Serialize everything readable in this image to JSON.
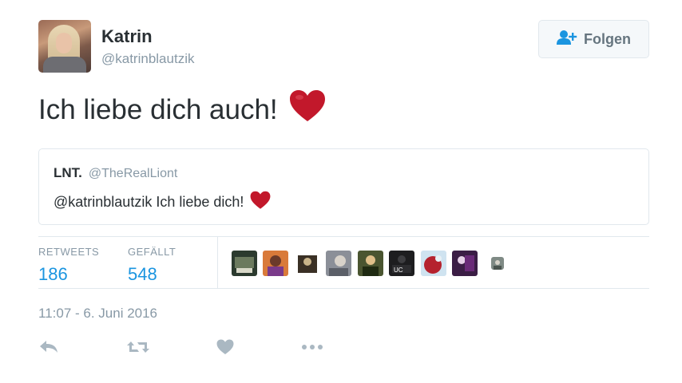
{
  "author": {
    "name": "Katrin",
    "handle": "@katrinblautzik"
  },
  "follow_button": {
    "label": "Folgen",
    "icon": "add-user-icon"
  },
  "tweet": {
    "text": "Ich liebe dich auch!",
    "emoji": "heart-icon"
  },
  "quoted_tweet": {
    "name": "LNT.",
    "handle": "@TheRealLiont",
    "text": "@katrinblautzik Ich liebe dich!",
    "emoji": "heart-icon"
  },
  "stats": {
    "retweets_label": "RETWEETS",
    "retweets_value": "186",
    "likes_label": "GEFÄLLT",
    "likes_value": "548"
  },
  "likers": [
    {
      "icon": "avatar-1",
      "color": "#2b3a2e"
    },
    {
      "icon": "avatar-2",
      "color": "#d97a3a"
    },
    {
      "icon": "avatar-3",
      "color": "#3a3025"
    },
    {
      "icon": "avatar-4",
      "color": "#8b8f98"
    },
    {
      "icon": "avatar-5",
      "color": "#4a5530"
    },
    {
      "icon": "avatar-6",
      "color": "#1d1d1f"
    },
    {
      "icon": "avatar-7",
      "color": "#b5222e"
    },
    {
      "icon": "avatar-8",
      "color": "#3b1d45"
    },
    {
      "icon": "avatar-9",
      "color": "#7f8a85"
    }
  ],
  "timestamp": "11:07 - 6. Juni 2016",
  "actions": [
    "reply-icon",
    "retweet-icon",
    "like-icon",
    "more-icon"
  ],
  "colors": {
    "heart": "#c2182b",
    "link_blue": "#1b95e0",
    "muted": "#8899a6",
    "border": "#e1e8ed",
    "text": "#292f33"
  }
}
